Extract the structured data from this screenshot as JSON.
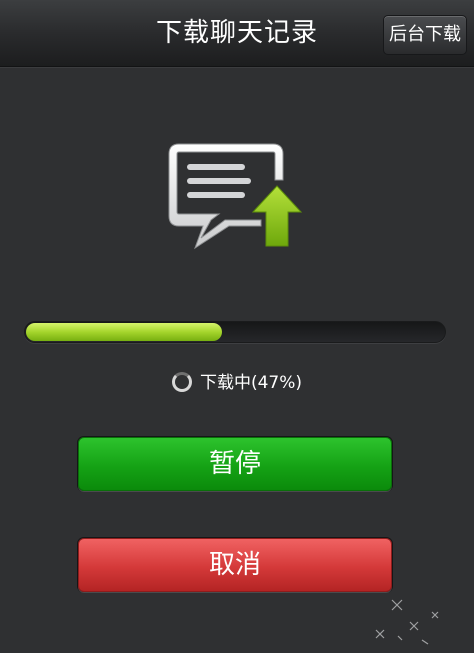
{
  "header": {
    "title": "下载聊天记录",
    "background_download_label": "后台下载"
  },
  "hero": {
    "icon": "chat-upload-icon"
  },
  "progress": {
    "percent": 47,
    "status_text": "下载中(47%)",
    "fill_color": "#a5d52c"
  },
  "actions": {
    "pause_label": "暂停",
    "cancel_label": "取消",
    "pause_color": "#15a215",
    "cancel_color": "#d43939"
  }
}
